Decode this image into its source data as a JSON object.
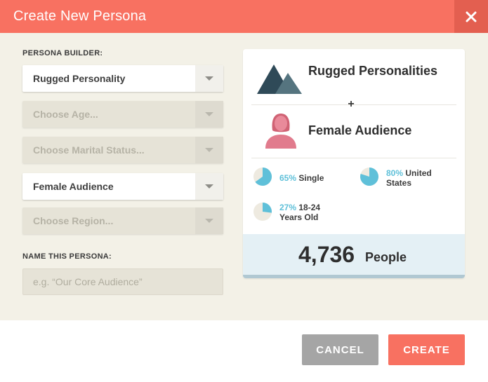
{
  "modal": {
    "title": "Create New Persona"
  },
  "builder": {
    "label": "PERSONA BUILDER:",
    "selects": [
      {
        "value": "Rugged Personality",
        "state": "selected"
      },
      {
        "value": "Choose Age...",
        "state": "disabled"
      },
      {
        "value": "Choose Marital Status...",
        "state": "disabled"
      },
      {
        "value": "Female Audience",
        "state": "selected"
      },
      {
        "value": "Choose Region...",
        "state": "disabled"
      }
    ]
  },
  "name_field": {
    "label": "NAME THIS PERSONA:",
    "placeholder": "e.g. “Our Core Audience”"
  },
  "summary": {
    "segment_one": "Rugged Personalities",
    "joiner": "+",
    "segment_two": "Female Audience",
    "stats": [
      {
        "percent": "65%",
        "label": "Single",
        "fraction": 0.65
      },
      {
        "percent": "80%",
        "label": "United States",
        "fraction": 0.8
      },
      {
        "percent": "27%",
        "label": "18-24 Years Old",
        "fraction": 0.27
      }
    ],
    "people_count": "4,736",
    "people_label": "People"
  },
  "footer": {
    "cancel_label": "CANCEL",
    "create_label": "CREATE"
  },
  "colors": {
    "accent": "#f87161",
    "accent_dark": "#e35f50",
    "stat_blue": "#5fc0d9",
    "mountain_dark": "#2f4a58",
    "mountain_light": "#55747f",
    "female_pink": "#e17b8d"
  }
}
